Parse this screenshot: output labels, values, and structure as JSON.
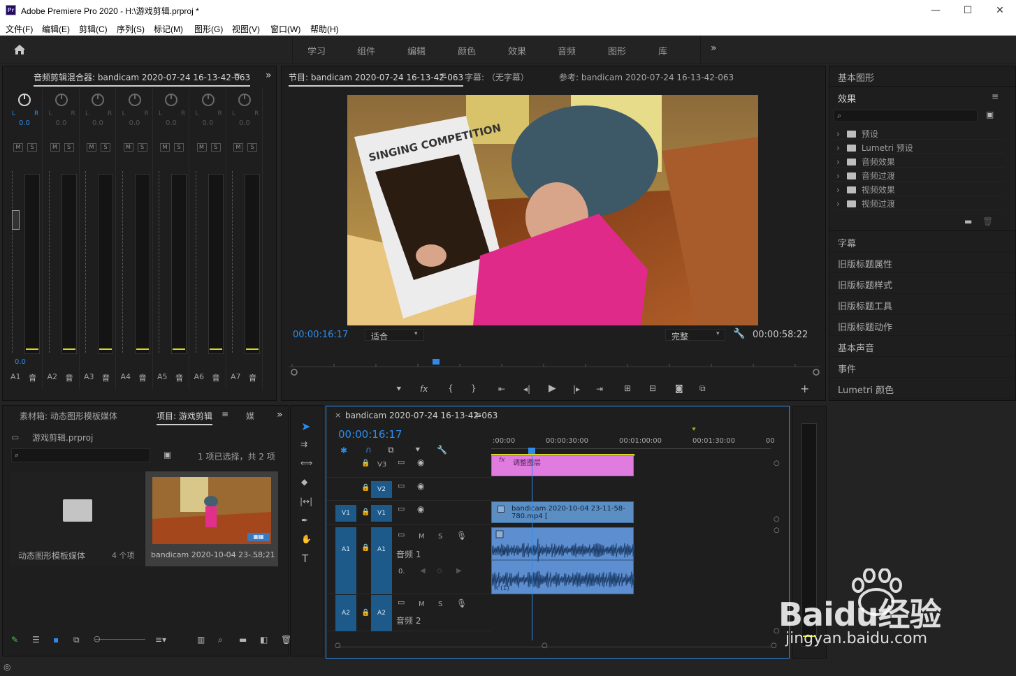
{
  "app": {
    "title": "Adobe Premiere Pro 2020 - H:\\游戏剪辑.prproj *",
    "badge": "Pr"
  },
  "window_controls": {
    "minimize": "—",
    "maximize": "☐",
    "close": "✕"
  },
  "menu": [
    "文件(F)",
    "编辑(E)",
    "剪辑(C)",
    "序列(S)",
    "标记(M)",
    "图形(G)",
    "视图(V)",
    "窗口(W)",
    "帮助(H)"
  ],
  "workspaces": [
    "学习",
    "组件",
    "编辑",
    "颜色",
    "效果",
    "音频",
    "图形",
    "库"
  ],
  "mixer": {
    "tab": "音频剪辑混合器: bandicam 2020-07-24 16-13-42-063",
    "channels": [
      {
        "label": "A1",
        "value": "0.0"
      },
      {
        "label": "A2",
        "value": "0.0"
      },
      {
        "label": "A3",
        "value": "0.0"
      },
      {
        "label": "A4",
        "value": "0.0"
      },
      {
        "label": "A5",
        "value": "0.0"
      },
      {
        "label": "A6",
        "value": "0.0"
      },
      {
        "label": "A7",
        "value": "0.0"
      }
    ],
    "fader_value": "0.0",
    "lr_l": "L",
    "lr_r": "R",
    "m": "M",
    "s": "S",
    "track_icon": "音"
  },
  "program": {
    "tab": "节目: bandicam 2020-07-24 16-13-42-063",
    "captions": "字幕: （无字幕）",
    "reference": "参考: bandicam 2020-07-24 16-13-42-063",
    "timecode": "00:00:16:17",
    "fit": "适合",
    "quality": "完整",
    "duration": "00:00:58:22",
    "video_caption": "SINGING COMPETITION"
  },
  "right_panel": {
    "essential_graphics": "基本图形",
    "effects_tab": "效果",
    "tree": [
      "预设",
      "Lumetri 预设",
      "音频效果",
      "音频过渡",
      "视频效果",
      "视频过渡"
    ],
    "items": [
      "字幕",
      "旧版标题属性",
      "旧版标题样式",
      "旧版标题工具",
      "旧版标题动作",
      "基本声音",
      "事件",
      "Lumetri 颜色"
    ]
  },
  "project": {
    "tab_bin": "素材箱: 动态图形模板媒体",
    "tab_project": "项目: 游戏剪辑",
    "tab_media": "媒",
    "file": "游戏剪辑.prproj",
    "selection": "1 项已选择，共 2 项",
    "bin_name": "动态图形模板媒体",
    "bin_count": "4 个项",
    "clip_name": "bandicam 2020-10-04 23-...",
    "clip_duration": "58;21"
  },
  "timeline": {
    "tab": "bandicam 2020-07-24 16-13-42-063",
    "timecode": "00:00:16:17",
    "ruler": [
      ":00:00",
      "00:00:30:00",
      "00:01:00:00",
      "00:01:30:00",
      "00"
    ],
    "tracks": {
      "v3": "V3",
      "v2": "V2",
      "v1": "V1",
      "a1": "A1",
      "a2": "A2",
      "audio1": "音频 1",
      "audio2": "音频 2",
      "m": "M",
      "s": "S",
      "zero": "0."
    },
    "clips": {
      "adjust": "调整图层",
      "video": "bandicam 2020-10-04 23-11-58-780.mp4 [",
      "fx": "fx",
      "left": "L (1)",
      "right": "R (1)"
    }
  },
  "watermark": {
    "brand": "Baidu经验",
    "url": "jingyan.baidu.com"
  },
  "colors": {
    "accent_blue": "#2d8ceb",
    "adjust_clip": "#e07ce0",
    "video_clip": "#5b8fc4",
    "audio_clip": "#5d8ed0"
  }
}
